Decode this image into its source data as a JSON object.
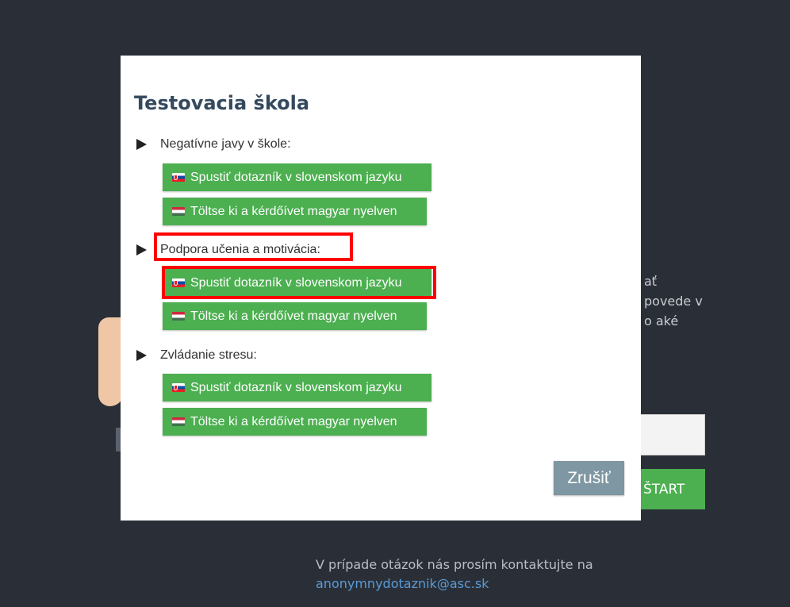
{
  "background": {
    "text_lines": [
      "ať",
      "povede v",
      "o aké"
    ],
    "start_label": "ŠTART",
    "footer_text": "V prípade otázok nás prosím kontaktujte na",
    "footer_email": "anonymnydotaznik@asc.sk"
  },
  "modal": {
    "title": "Testovacia škola",
    "sections": [
      {
        "label": "Negatívne javy v škole:",
        "buttons": [
          {
            "label": "Spustiť dotazník v slovenskom jazyku",
            "flag": "slovak-flag-icon"
          },
          {
            "label": "Töltse ki a kérdőívet magyar nyelven",
            "flag": "hungarian-flag-icon"
          }
        ]
      },
      {
        "label": "Podpora učenia a motivácia:",
        "highlighted": true,
        "buttons": [
          {
            "label": "Spustiť dotazník v slovenskom jazyku",
            "flag": "slovak-flag-icon",
            "highlighted": true
          },
          {
            "label": "Töltse ki a kérdőívet magyar nyelven",
            "flag": "hungarian-flag-icon"
          }
        ]
      },
      {
        "label": "Zvládanie stresu:",
        "buttons": [
          {
            "label": "Spustiť dotazník v slovenskom jazyku",
            "flag": "slovak-flag-icon"
          },
          {
            "label": "Töltse ki a kérdőívet magyar nyelven",
            "flag": "hungarian-flag-icon"
          }
        ]
      }
    ],
    "cancel_label": "Zrušiť"
  },
  "colors": {
    "page_background": "#2a2f37",
    "button_green": "#4caf50",
    "cancel_button": "#7f96a3",
    "title_color": "#34495e",
    "highlight": "#ff0000"
  }
}
